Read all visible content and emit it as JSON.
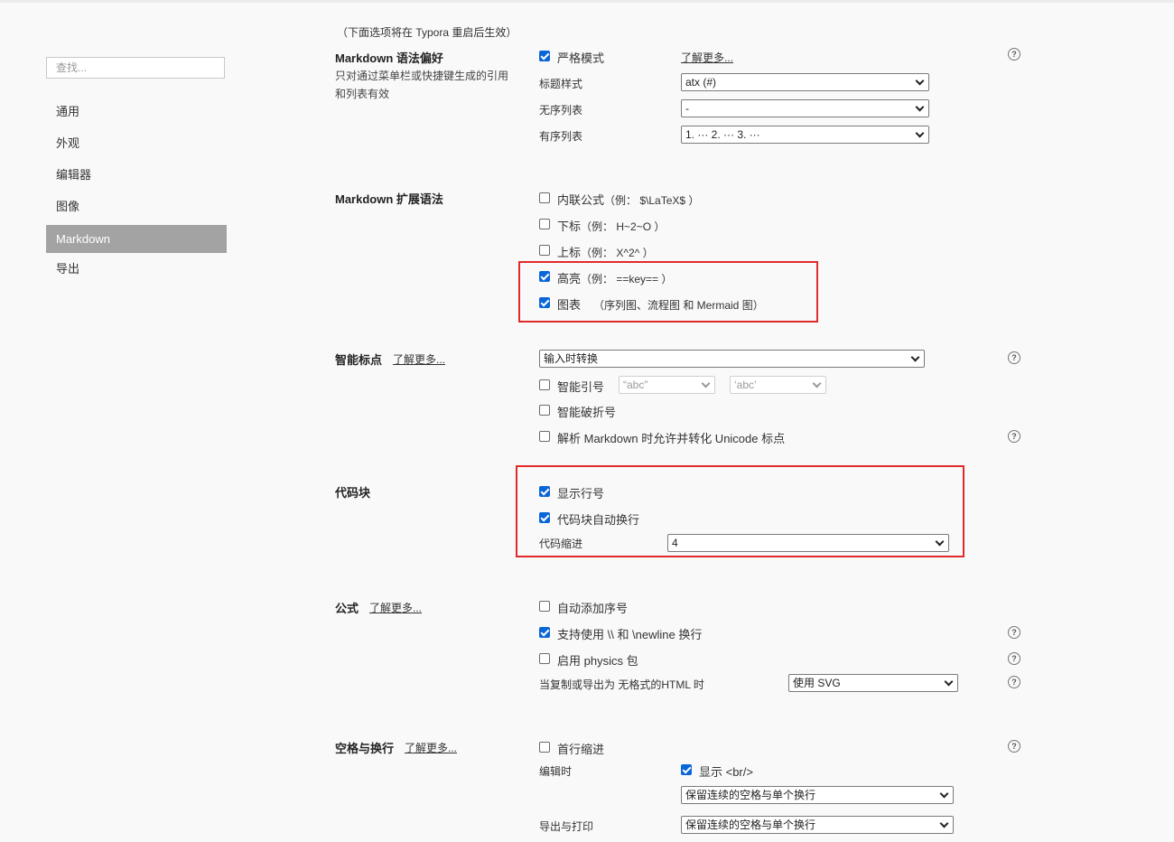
{
  "sidebar": {
    "search_placeholder": "查找...",
    "items": [
      {
        "label": "通用"
      },
      {
        "label": "外观"
      },
      {
        "label": "编辑器"
      },
      {
        "label": "图像"
      },
      {
        "label": "Markdown"
      },
      {
        "label": "导出"
      }
    ],
    "active": "Markdown"
  },
  "restart_hint": "（下面选项将在 Typora 重启后生效）",
  "syntax_pref": {
    "title": "Markdown 语法偏好",
    "desc_line1": "只对通过菜单栏或快捷键生成的引用",
    "desc_line2": "和列表有效",
    "strict_mode": {
      "label": "严格模式",
      "checked": true
    },
    "learn_more": "了解更多...",
    "heading_style": {
      "label": "标题样式",
      "value": "atx (#)"
    },
    "unordered_list": {
      "label": "无序列表",
      "value": "-"
    },
    "ordered_list": {
      "label": "有序列表",
      "value": "1. ··· 2. ··· 3. ···"
    }
  },
  "ext_syntax": {
    "title": "Markdown 扩展语法",
    "inline_math": {
      "label": "内联公式",
      "example": "（例： $\\LaTeX$ ）",
      "checked": false
    },
    "subscript": {
      "label": "下标",
      "example": "（例： H~2~O ）",
      "checked": false
    },
    "superscript": {
      "label": "上标",
      "example": "（例： X^2^ ）",
      "checked": false
    },
    "highlight": {
      "label": "高亮",
      "example": "（例： ==key== ）",
      "checked": true
    },
    "diagrams": {
      "label": "图表",
      "example": "（序列图、流程图 和 Mermaid 图）",
      "checked": true
    }
  },
  "smart_punct": {
    "title": "智能标点",
    "learn_more": "了解更多...",
    "mode_value": "输入时转换",
    "smart_quotes": {
      "label": "智能引号",
      "checked": false,
      "double_value": "“abc”",
      "single_value": "‘abc’"
    },
    "smart_dashes": {
      "label": "智能破折号",
      "checked": false
    },
    "unicode_punct": {
      "label": "解析 Markdown 时允许并转化 Unicode 标点",
      "checked": false
    }
  },
  "code_block": {
    "title": "代码块",
    "line_numbers": {
      "label": "显示行号",
      "checked": true
    },
    "auto_wrap": {
      "label": "代码块自动换行",
      "checked": true
    },
    "indent": {
      "label": "代码缩进",
      "value": "4"
    }
  },
  "math": {
    "title": "公式",
    "learn_more": "了解更多...",
    "auto_numbering": {
      "label": "自动添加序号",
      "checked": false
    },
    "newline": {
      "label": "支持使用 \\\\ 和 \\newline 换行",
      "checked": true
    },
    "physics": {
      "label": "启用 physics 包",
      "checked": false
    },
    "export_label": "当复制或导出为 无格式的HTML 时",
    "export_value": "使用 SVG"
  },
  "whitespace": {
    "title": "空格与换行",
    "learn_more": "了解更多...",
    "first_indent": {
      "label": "首行缩进",
      "checked": false
    },
    "editing_label": "编辑时",
    "show_br": {
      "label": "显示 <br/>",
      "checked": true
    },
    "editing_value": "保留连续的空格与单个换行",
    "export_label": "导出与打印",
    "export_value": "保留连续的空格与单个换行"
  },
  "help_icon": "?",
  "colors": {
    "accent": "#0a66d8",
    "active_nav": "#a3a3a3",
    "highlight_box": "#e12b2b"
  }
}
